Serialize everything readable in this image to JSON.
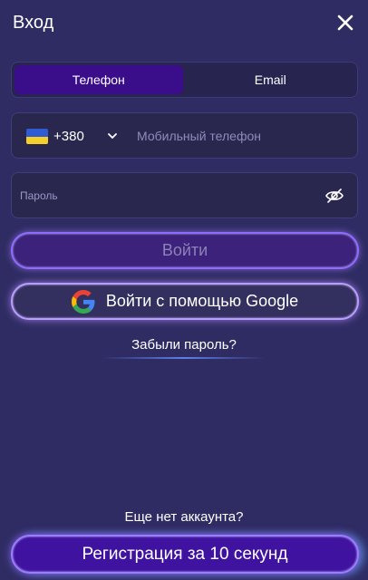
{
  "header": {
    "title": "Вход",
    "close_icon": "close-icon"
  },
  "tabs": [
    {
      "label": "Телефон",
      "active": true
    },
    {
      "label": "Email",
      "active": false
    }
  ],
  "phone": {
    "country_icon": "ukraine-flag-icon",
    "dial_code": "+380",
    "value": "",
    "placeholder": "Мобильный телефон"
  },
  "password": {
    "value": "",
    "placeholder": "Пароль",
    "toggle_icon": "eye-hidden-icon"
  },
  "buttons": {
    "login_label": "Войти",
    "google_label": "Войти с помощью Google",
    "google_icon": "google-icon",
    "register_label": "Регистрация за 10 секунд"
  },
  "links": {
    "forgot_password": "Забыли пароль?",
    "no_account": "Еще нет аккаунта?"
  },
  "colors": {
    "background": "#2f2c63",
    "active_tab": "#3a0e8a",
    "button_glow": "#8d6dff"
  }
}
